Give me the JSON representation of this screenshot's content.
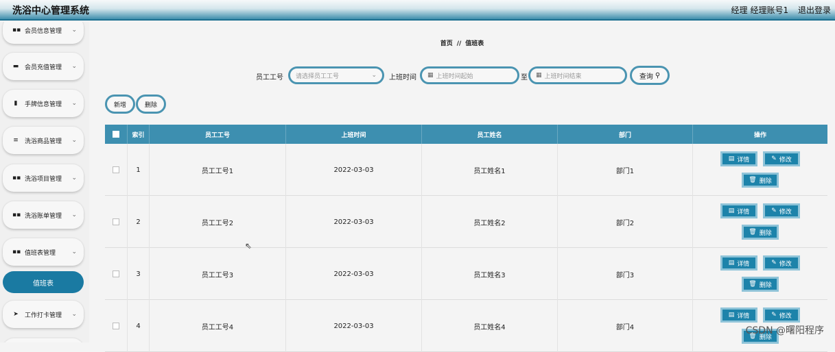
{
  "header": {
    "title": "洗浴中心管理系统",
    "role": "经理",
    "account": "经理账号1",
    "logout": "退出登录"
  },
  "sidebar": {
    "items": [
      {
        "label": "会员信息管理",
        "icon": "grid-icon"
      },
      {
        "label": "会员充值管理",
        "icon": "card-icon"
      },
      {
        "label": "手牌信息管理",
        "icon": "clipboard-icon"
      },
      {
        "label": "洗浴商品管理",
        "icon": "list-icon"
      },
      {
        "label": "洗浴项目管理",
        "icon": "grid-icon"
      },
      {
        "label": "洗浴账单管理",
        "icon": "grid-icon"
      },
      {
        "label": "值班表管理",
        "icon": "grid-icon"
      },
      {
        "label": "工作打卡管理",
        "icon": "send-icon"
      }
    ],
    "active_sub": "值班表"
  },
  "breadcrumb": {
    "home": "首页",
    "separator": "//",
    "current": "值班表"
  },
  "search": {
    "employee_label": "员工工号",
    "employee_placeholder": "请选择员工工号",
    "time_label": "上班时间",
    "start_placeholder": "上班时间起始",
    "to": "至",
    "end_placeholder": "上班时间结束",
    "query": "查询"
  },
  "actions": {
    "add": "新增",
    "delete": "删除"
  },
  "table": {
    "columns": [
      "索引",
      "员工工号",
      "上班时间",
      "员工姓名",
      "部门",
      "操作"
    ],
    "rows": [
      {
        "index": "1",
        "emp_no": "员工工号1",
        "time": "2022-03-03",
        "name": "员工姓名1",
        "dept": "部门1"
      },
      {
        "index": "2",
        "emp_no": "员工工号2",
        "time": "2022-03-03",
        "name": "员工姓名2",
        "dept": "部门2"
      },
      {
        "index": "3",
        "emp_no": "员工工号3",
        "time": "2022-03-03",
        "name": "员工姓名3",
        "dept": "部门3"
      },
      {
        "index": "4",
        "emp_no": "员工工号4",
        "time": "2022-03-03",
        "name": "员工姓名4",
        "dept": "部门4"
      }
    ],
    "op_detail": "详情",
    "op_edit": "修改",
    "op_delete": "删除"
  },
  "watermark": "CSDN @曙阳程序",
  "colors": {
    "accent": "#1d83aa",
    "header_bg": "#3d8fb0",
    "border": "#4a94b1"
  }
}
